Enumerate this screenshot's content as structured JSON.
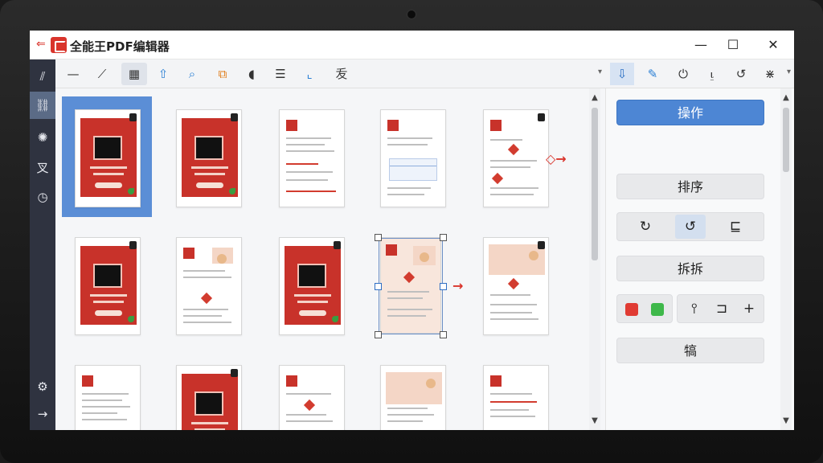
{
  "app": {
    "title": "全能王PDF编辑器",
    "back_glyph": "⇐"
  },
  "window": {
    "minimize": "—",
    "maximize": "☐",
    "close": "✕"
  },
  "leftnav": [
    {
      "name": "nav-chart",
      "glyph": "⫽"
    },
    {
      "name": "nav-link",
      "glyph": "⛓"
    },
    {
      "name": "nav-gear",
      "glyph": "✺"
    },
    {
      "name": "nav-edit",
      "glyph": "叉"
    },
    {
      "name": "nav-clock",
      "glyph": "◷"
    }
  ],
  "leftnav_bottom": [
    {
      "name": "nav-settings",
      "glyph": "⚙"
    },
    {
      "name": "nav-exit",
      "glyph": "→"
    }
  ],
  "toolbar": [
    {
      "name": "minus-tool",
      "glyph": "—"
    },
    {
      "name": "pen-tool",
      "glyph": "⟋"
    },
    {
      "name": "layout-tool",
      "glyph": "▦"
    },
    {
      "name": "upload-tool",
      "glyph": "⇧"
    },
    {
      "name": "search-tool",
      "glyph": "⌕"
    },
    {
      "name": "stamp-tool",
      "glyph": "⧉"
    },
    {
      "name": "audio-tool",
      "glyph": "◖"
    },
    {
      "name": "list-tool",
      "glyph": "☰"
    },
    {
      "name": "insert-tool",
      "glyph": "⌞"
    },
    {
      "name": "char-tool",
      "glyph": "叐"
    }
  ],
  "right_toolbar": [
    {
      "name": "extract-tool",
      "glyph": "⇩"
    },
    {
      "name": "pin-tool",
      "glyph": "✎"
    },
    {
      "name": "power-tool",
      "glyph": "⏻"
    },
    {
      "name": "sign-tool",
      "glyph": "⍸"
    },
    {
      "name": "history-tool",
      "glyph": "↺"
    },
    {
      "name": "more-tool",
      "glyph": "⋇"
    }
  ],
  "panel": {
    "operate_label": "操作",
    "sort_label": "排序",
    "split_label": "拆拆",
    "bottom_label": "犒",
    "rotate_left": "↻",
    "rotate_right": "↺",
    "insert": "⊑",
    "split_a": "⫯",
    "split_b": "⊐",
    "split_c": "+"
  },
  "colors": {
    "accent": "#4d86d4",
    "brand": "#d9342b",
    "swatch_red": "#e03b33",
    "swatch_green": "#3eb84a"
  }
}
